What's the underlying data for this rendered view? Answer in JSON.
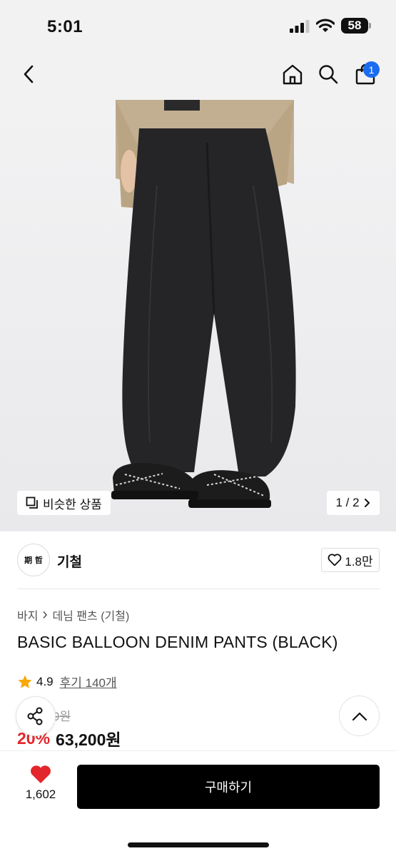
{
  "status_bar": {
    "time": "5:01",
    "battery": "58"
  },
  "nav": {
    "cart_count": "1"
  },
  "image": {
    "similar_label": "비슷한 상품",
    "page_indicator": "1 / 2"
  },
  "brand": {
    "logo_text": "期 哲",
    "name": "기철",
    "likes": "1.8만"
  },
  "breadcrumb": {
    "category": "바지",
    "subcategory": "데님 팬츠 (기철)"
  },
  "product": {
    "title": "BASIC BALLOON DENIM PANTS (BLACK)",
    "rating": "4.9",
    "reviews": "후기 140개",
    "original_price": "9원",
    "discount": "20%",
    "price": "63,200원"
  },
  "bottom": {
    "wish_count": "1,602",
    "buy_label": "구매하기"
  },
  "colors": {
    "accent": "#e3262b",
    "badge": "#1a6cf0",
    "buy_button": "#000000",
    "star": "#f7a80a"
  },
  "icons": [
    "back-icon",
    "home-icon",
    "search-icon",
    "cart-icon",
    "similar-icon",
    "chevron-right-icon",
    "heart-outline-icon",
    "star-icon",
    "share-icon",
    "chevron-up-icon",
    "heart-filled-icon"
  ]
}
